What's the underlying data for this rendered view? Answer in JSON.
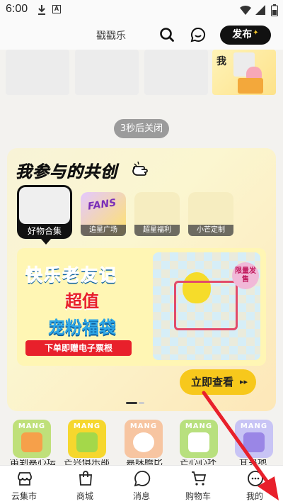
{
  "status_bar": {
    "time": "6:00"
  },
  "header": {
    "title": "戳戳乐",
    "publish_label": "发布",
    "publish_star": "✦"
  },
  "thumbnails": {
    "t4_text": "我"
  },
  "close_toast": "3秒后关闭",
  "cocreate": {
    "title": "我参与的共创",
    "tabs": [
      {
        "label": "好物合集"
      },
      {
        "label": "追星广场",
        "art_text": "FANS"
      },
      {
        "label": "超星福利"
      },
      {
        "label": "小芒定制"
      }
    ],
    "banner": {
      "line1": "快乐老友记",
      "line2": "超值",
      "line3": "宠粉福袋",
      "ticket": "下单即赠电子票根",
      "badge": "限量发售"
    },
    "view_button": "立即查看",
    "view_arrows": "▸▸"
  },
  "shortcuts": [
    {
      "mang": "MANG",
      "label": "笛到嘉心坛"
    },
    {
      "mang": "MANG",
      "label": "芒兴俱乐部"
    },
    {
      "mang": "MANG",
      "label": "嘉味腾比"
    },
    {
      "mang": "MANG",
      "label": "芒心心坏"
    },
    {
      "mang": "MANG",
      "label": "甘男地"
    }
  ],
  "bottom_nav": [
    {
      "label": "云集市",
      "icon": "store-icon"
    },
    {
      "label": "商城",
      "icon": "bag-icon"
    },
    {
      "label": "消息",
      "icon": "chat-icon"
    },
    {
      "label": "购物车",
      "icon": "cart-icon"
    },
    {
      "label": "我的",
      "icon": "profile-icon"
    }
  ],
  "colors": {
    "accent_yellow": "#f7c81c",
    "annotation_red": "#e8202b"
  }
}
